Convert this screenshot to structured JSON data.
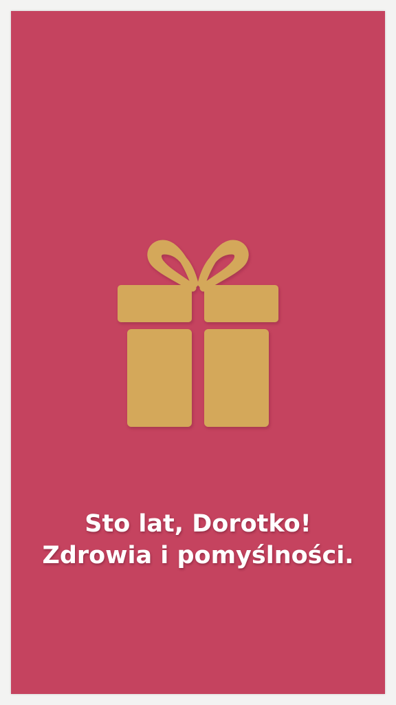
{
  "card": {
    "background_color": "#c5435f",
    "icon": "gift-icon",
    "icon_color": "#d4a85a",
    "message": {
      "line1": "Sto lat, Dorotko!",
      "line2": "Zdrowia i pomyślności."
    }
  }
}
